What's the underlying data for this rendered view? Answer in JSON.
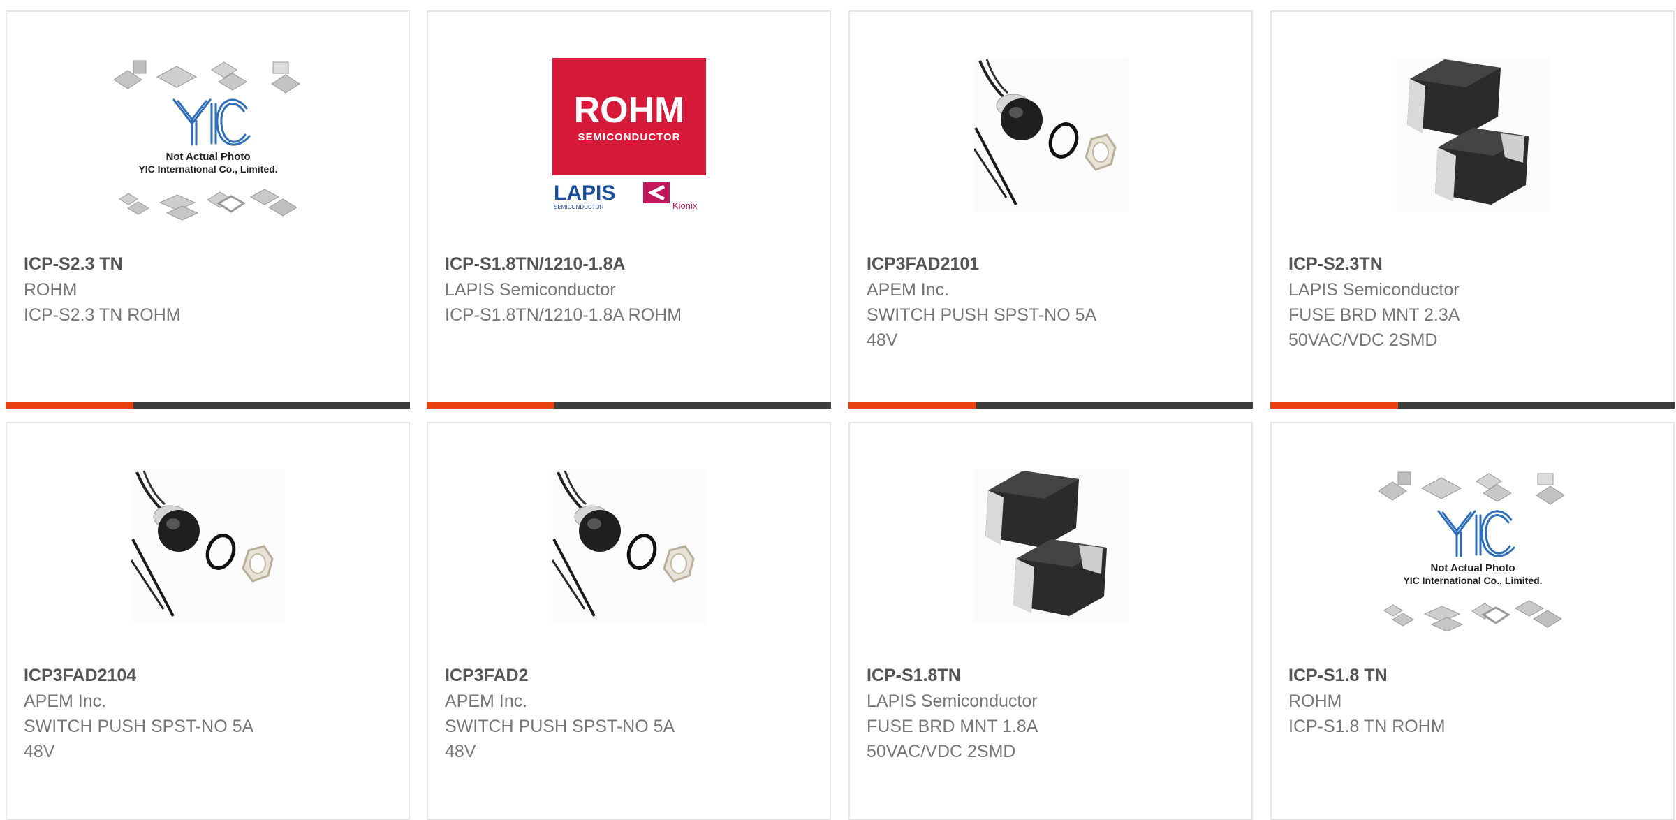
{
  "colors": {
    "accent": "#e8410f",
    "bar": "#3c3c3c",
    "border": "#e6e6e6",
    "partNumber": "#555555",
    "text": "#777777"
  },
  "products": [
    {
      "part_number": "ICP-S2.3 TN",
      "manufacturer": "ROHM",
      "description": "ICP-S2.3 TN ROHM",
      "image": "placeholder-photo-icon",
      "img_line1": "Not Actual Photo",
      "img_line2": "YIC International Co., Limited."
    },
    {
      "part_number": "ICP-S1.8TN/1210-1.8A",
      "manufacturer": "LAPIS Semiconductor",
      "description": "ICP-S1.8TN/1210-1.8A ROHM",
      "image": "rohm-logo-icon",
      "logo_main": "ROHM",
      "logo_sub": "SEMICONDUCTOR",
      "logo_lapis": "LAPIS",
      "logo_lapis_sub": "SEMICONDUCTOR",
      "logo_kionix": "Kionix"
    },
    {
      "part_number": "ICP3FAD2101",
      "manufacturer": "APEM Inc.",
      "description": "SWITCH PUSH SPST-NO 5A\n48V",
      "image": "push-switch-icon"
    },
    {
      "part_number": "ICP-S2.3TN",
      "manufacturer": "LAPIS Semiconductor",
      "description": "FUSE BRD MNT 2.3A\n50VAC/VDC 2SMD",
      "image": "smd-fuse-icon"
    },
    {
      "part_number": "ICP3FAD2104",
      "manufacturer": "APEM Inc.",
      "description": "SWITCH PUSH SPST-NO 5A\n48V",
      "image": "push-switch-icon"
    },
    {
      "part_number": "ICP3FAD2",
      "manufacturer": "APEM Inc.",
      "description": "SWITCH PUSH SPST-NO 5A\n48V",
      "image": "push-switch-icon"
    },
    {
      "part_number": "ICP-S1.8TN",
      "manufacturer": "LAPIS Semiconductor",
      "description": "FUSE BRD MNT 1.8A\n50VAC/VDC 2SMD",
      "image": "smd-fuse-icon"
    },
    {
      "part_number": "ICP-S1.8 TN",
      "manufacturer": "ROHM",
      "description": "ICP-S1.8 TN ROHM",
      "image": "placeholder-photo-icon",
      "img_line1": "Not Actual Photo",
      "img_line2": "YIC International Co., Limited."
    }
  ]
}
